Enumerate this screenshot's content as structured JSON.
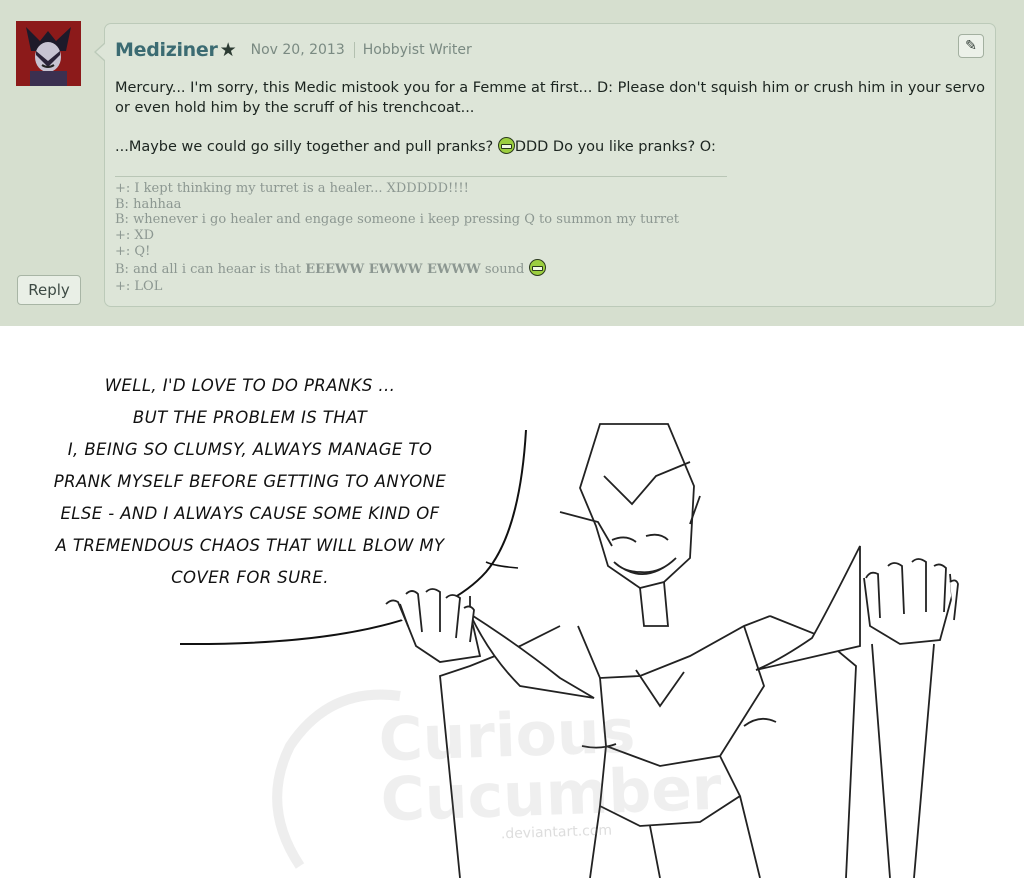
{
  "comment": {
    "username": "Mediziner",
    "date": "Nov 20, 2013",
    "role": "Hobbyist Writer",
    "reply_label": "Reply",
    "paragraph1": "Mercury... I'm sorry, this Medic mistook you for a Femme at first... D: Please don't squish him or crush him in your servo or even hold him by the scruff of his trenchcoat...",
    "paragraph2_a": "...Maybe we could go silly together and pull pranks?",
    "paragraph2_b": "DDD Do you like pranks? O:",
    "chat": {
      "l1": "+: I kept thinking my turret is a healer... XDDDDD!!!!",
      "l2": "B: hahhaa",
      "l3": "B: whenever i go healer and engage someone i keep pressing Q to summon my turret",
      "l4": "+: XD",
      "l5": "+: Q!",
      "l6_a": "B: and all i can heaar is that",
      "l6_b": "EEEWW EWWW EWWW",
      "l6_c": "sound",
      "l7": "+: LOL"
    }
  },
  "comic": {
    "caption_lines": [
      "Well, I'd love to do pranks ...",
      "but the problem is that",
      "I, being so clumsy, always manage to",
      "prank myself before getting to anyone",
      "else - and I always cause some kind of",
      "a tremendous chaos that will blow my",
      "cover for sure."
    ],
    "watermark_text": "Curious Cucumber",
    "watermark_site": ".deviantart.com"
  }
}
